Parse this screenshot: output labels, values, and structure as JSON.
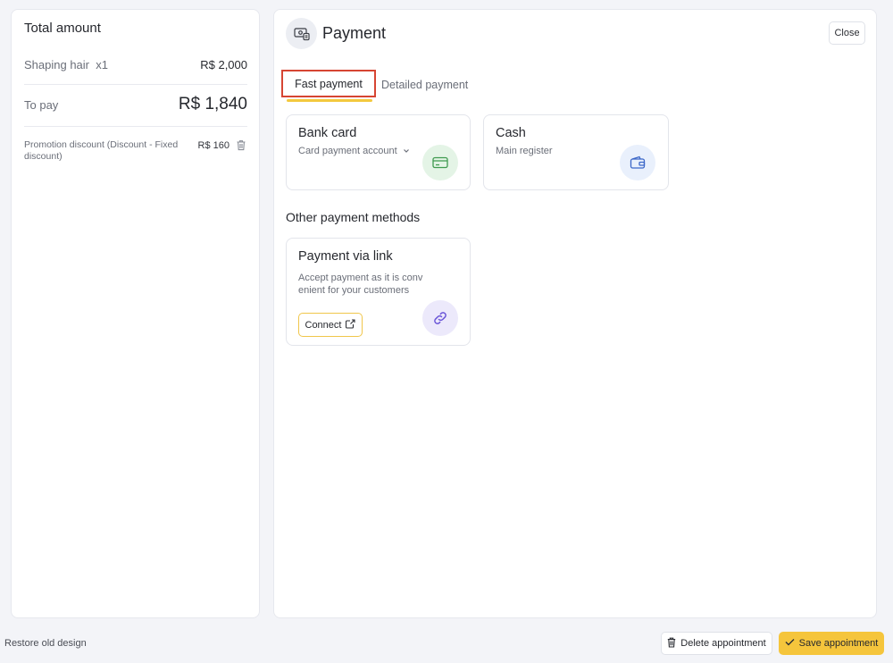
{
  "summary": {
    "title": "Total amount",
    "service_name": "Shaping hair  x1",
    "service_price": "R$ 2,000",
    "to_pay_label": "To pay",
    "to_pay_value": "R$ 1,840",
    "promo_label": "Promotion discount (Discount - Fixed discount)",
    "promo_value": "R$ 160"
  },
  "payment": {
    "title": "Payment",
    "close_label": "Close",
    "tabs": [
      {
        "label": "Fast payment",
        "active": true
      },
      {
        "label": "Detailed payment",
        "active": false
      }
    ],
    "fast_methods": [
      {
        "title": "Bank card",
        "subtitle": "Card payment account",
        "icon": "credit-card-icon",
        "icon_bg": "#e4f4e6",
        "icon_color": "#3f9a4f"
      },
      {
        "title": "Cash",
        "subtitle": "Main register",
        "icon": "wallet-icon",
        "icon_bg": "#e9f0fc",
        "icon_color": "#3c67c8"
      }
    ],
    "other_title": "Other payment methods",
    "link_method": {
      "title": "Payment via link",
      "description": "Accept payment as it is conv enient for your customers",
      "connect_label": "Connect",
      "icon": "link-icon",
      "icon_bg": "#ece9fb",
      "icon_color": "#6a55d8"
    }
  },
  "footer": {
    "restore_label": "Restore old design",
    "delete_label": "Delete appointment",
    "save_label": "Save appointment"
  },
  "colors": {
    "accent": "#f5c53c",
    "highlight_box": "#d64533"
  }
}
